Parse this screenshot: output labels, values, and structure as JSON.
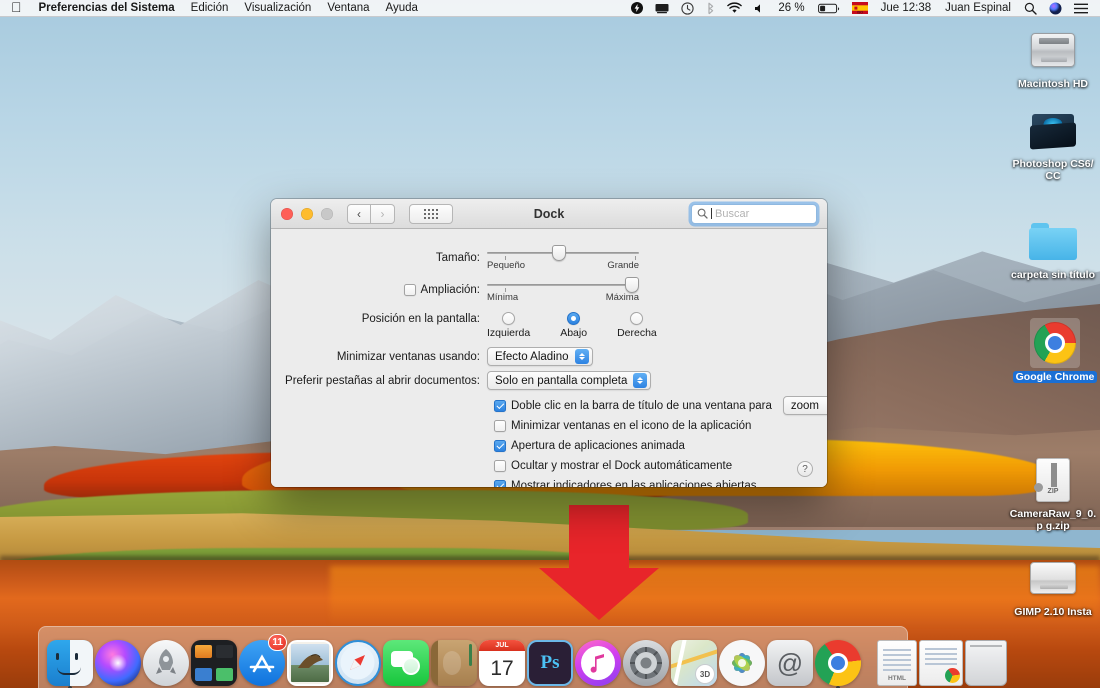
{
  "menubar": {
    "apple_icon": "apple-logo",
    "app_name": "Preferencias del Sistema",
    "menus": [
      "Edición",
      "Visualización",
      "Ventana",
      "Ayuda"
    ],
    "status_icons": [
      "flash-icon",
      "display-icon",
      "time-machine-icon",
      "bluetooth-icon",
      "wifi-icon",
      "volume-icon"
    ],
    "battery_percent": "26 %",
    "input_source": "ISO",
    "clock": "Jue 12:38",
    "user": "Juan Espinal",
    "right_icons": [
      "search-icon",
      "siri-icon",
      "notification-center-icon"
    ]
  },
  "desktop": {
    "icons": [
      {
        "label": "Macintosh HD",
        "kind": "hard-disk",
        "selected": false
      },
      {
        "label": "Photoshop CS6/ CC",
        "kind": "folder-dark",
        "selected": false
      },
      {
        "label": "carpeta sin título",
        "kind": "folder-blue",
        "selected": false
      },
      {
        "label": "Google Chrome",
        "kind": "chrome-app",
        "selected": true
      },
      {
        "label": "CameraRaw_9_0.p g.zip",
        "kind": "zip-archive",
        "selected": false
      },
      {
        "label": "GIMP 2.10 Insta",
        "kind": "disk-image",
        "selected": false
      }
    ]
  },
  "annotation": {
    "arrow_color": "#e8252a",
    "highlight_color": "#e8252a",
    "highlight_target": "Ocultar y mostrar el Dock automáticamente"
  },
  "window": {
    "title": "Dock",
    "nav": {
      "back": "‹",
      "forward": "›",
      "grid": "show-all-grid"
    },
    "traffic_lights": [
      "close",
      "minimize",
      "zoom"
    ],
    "search": {
      "placeholder": "Buscar",
      "value": ""
    },
    "help_label": "?",
    "rows": {
      "size": {
        "label": "Tamaño:",
        "min_label": "Pequeño",
        "max_label": "Grande",
        "value_percent": 48
      },
      "magnification": {
        "label": "Ampliación:",
        "checked": false,
        "min_label": "Mínima",
        "max_label": "Máxima",
        "value_percent": 100
      },
      "position": {
        "label": "Posición en la pantalla:",
        "options": [
          "Izquierda",
          "Abajo",
          "Derecha"
        ],
        "selected": "Abajo"
      },
      "minimize_effect": {
        "label": "Minimizar ventanas usando:",
        "value": "Efecto Aladino"
      },
      "prefer_tabs": {
        "label": "Preferir pestañas al abrir documentos:",
        "value": "Solo en pantalla completa"
      }
    },
    "checkboxes": [
      {
        "label": "Doble clic en la barra de título de una ventana para",
        "checked": true,
        "popup": "zoom"
      },
      {
        "label": "Minimizar ventanas en el icono de la aplicación",
        "checked": false
      },
      {
        "label": "Apertura de aplicaciones animada",
        "checked": true
      },
      {
        "label": "Ocultar y mostrar el Dock automáticamente",
        "checked": false,
        "highlighted": true
      },
      {
        "label": "Mostrar indicadores en las aplicaciones abiertas",
        "checked": true
      }
    ]
  },
  "dock": {
    "items": [
      {
        "name": "Finder",
        "running": true
      },
      {
        "name": "Siri",
        "running": false
      },
      {
        "name": "Launchpad",
        "running": false
      },
      {
        "name": "Mission Control",
        "running": false
      },
      {
        "name": "App Store",
        "running": false,
        "badge": "11"
      },
      {
        "name": "Mail",
        "running": false
      },
      {
        "name": "Safari",
        "running": false
      },
      {
        "name": "Mensajes",
        "running": false
      },
      {
        "name": "Contactos",
        "running": false
      },
      {
        "name": "Calendario",
        "running": false,
        "day": "17",
        "month": "JUL"
      },
      {
        "name": "Photoshop",
        "running": false,
        "glyph": "Ps"
      },
      {
        "name": "iTunes",
        "running": false
      },
      {
        "name": "Preferencias del Sistema",
        "running": false
      },
      {
        "name": "Mapas",
        "running": false
      },
      {
        "name": "Fotos",
        "running": false
      },
      {
        "name": "Correo",
        "running": false,
        "glyph": "@"
      },
      {
        "name": "Google Chrome",
        "running": true
      }
    ],
    "files": [
      {
        "name": "documento HTML",
        "glyph": "HTML"
      },
      {
        "name": "documento",
        "glyph": ""
      }
    ],
    "trash": "Papelera"
  }
}
